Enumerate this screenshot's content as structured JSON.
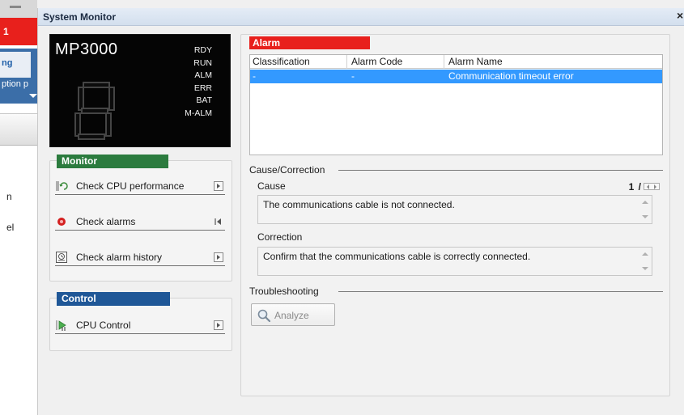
{
  "background": {
    "red_bar_text": "1",
    "tab_text": "ng",
    "subtab_text": "ption p",
    "items": [
      "n",
      "el"
    ]
  },
  "dialog": {
    "title": "System Monitor",
    "close": "×"
  },
  "plc": {
    "model": "MP3000",
    "leds": [
      "RDY",
      "RUN",
      "ALM",
      "ERR",
      "BAT",
      "M-ALM"
    ],
    "display_digit": "8"
  },
  "monitor": {
    "header": "Monitor",
    "actions": [
      {
        "label": "Check CPU performance",
        "icon": "cpu-performance-icon"
      },
      {
        "label": "Check alarms",
        "icon": "alarm-icon"
      },
      {
        "label": "Check alarm history",
        "icon": "alarm-history-icon"
      }
    ]
  },
  "control": {
    "header": "Control",
    "actions": [
      {
        "label": "CPU Control",
        "icon": "cpu-control-icon"
      }
    ]
  },
  "alarm": {
    "header": "Alarm",
    "columns": [
      "Classification",
      "Alarm Code",
      "Alarm Name"
    ],
    "rows": [
      {
        "classification": "-",
        "code": "-",
        "name": "Communication timeout error",
        "selected": true
      }
    ]
  },
  "cause_correction": {
    "title": "Cause/Correction",
    "cause_label": "Cause",
    "pager": "1 / 3",
    "cause_text": "The communications cable is not connected.",
    "correction_label": "Correction",
    "correction_text": "Confirm that the communications cable is correctly connected."
  },
  "troubleshooting": {
    "title": "Troubleshooting",
    "analyze_label": "Analyze"
  },
  "colors": {
    "alarm_red": "#e8201c",
    "monitor_green": "#2b7b3e",
    "control_blue": "#1f5797",
    "selection_blue": "#3399ff"
  }
}
